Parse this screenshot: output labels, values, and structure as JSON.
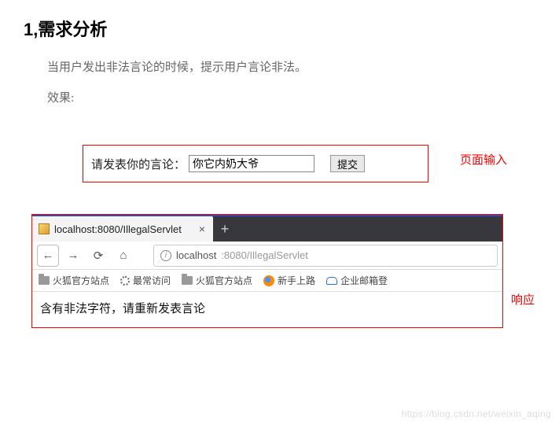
{
  "heading": "1,需求分析",
  "para1": "当用户发出非法言论的时候，提示用户言论非法。",
  "para2": "效果:",
  "form": {
    "label": "请发表你的言论：",
    "value": "你它内奶大爷",
    "submit": "提交"
  },
  "callouts": {
    "input": "页面输入",
    "response": "响应"
  },
  "browser": {
    "tab_title": "localhost:8080/IllegalServlet",
    "url_host": "localhost",
    "url_rest": ":8080/IllegalServlet",
    "bookmarks": {
      "b1": "火狐官方站点",
      "b2": "最常访问",
      "b3": "火狐官方站点",
      "b4": "新手上路",
      "b5": "企业邮箱登"
    },
    "body_text": "含有非法字符，请重新发表言论"
  },
  "watermark": "https://blog.csdn.net/weixin_aqing"
}
